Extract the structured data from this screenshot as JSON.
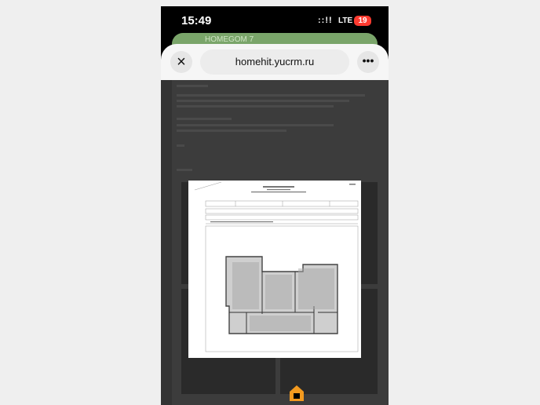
{
  "status": {
    "time": "15:49",
    "signal": "::!!",
    "network": "LTE",
    "battery": "19"
  },
  "browser": {
    "url": "homehit.yucrm.ru",
    "tab_peek_title": "HOMEGOM 7"
  },
  "document": {
    "title": "КАДАСТРОВЫЙ ПАСПОРТ",
    "page_label": "ЛИСТ 1"
  },
  "icons": {
    "close": "×",
    "more": "•••",
    "logo": "house-logo"
  },
  "colors": {
    "accent_logo": "#f39a1f",
    "battery": "#ff3b30"
  }
}
